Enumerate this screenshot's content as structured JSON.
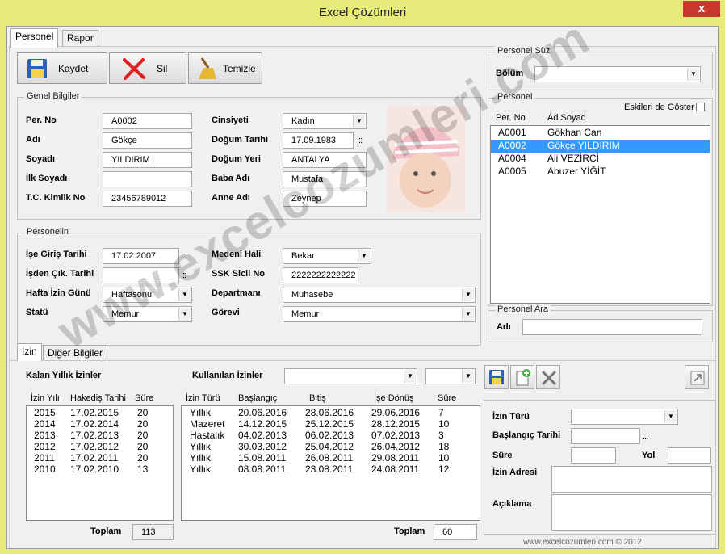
{
  "window": {
    "title": "Excel Çözümleri",
    "close_glyph": "x"
  },
  "tabs": [
    {
      "label": "Personel"
    },
    {
      "label": "Rapor"
    }
  ],
  "toolbar": {
    "save_label": "Kaydet",
    "delete_label": "Sil",
    "clear_label": "Temizle"
  },
  "general": {
    "legend": "Genel Bilgiler",
    "per_no_label": "Per. No",
    "per_no": "A0002",
    "adi_label": "Adı",
    "adi": "Gökçe",
    "soyadi_label": "Soyadı",
    "soyadi": "YILDIRIM",
    "ilk_soyadi_label": "İlk Soyadı",
    "ilk_soyadi": "",
    "tc_label": "T.C. Kimlik No",
    "tc": "23456789012",
    "cinsiyet_label": "Cinsiyeti",
    "cinsiyet": "Kadın",
    "dogum_tarihi_label": "Doğum Tarihi",
    "dogum_tarihi": "17.09.1983",
    "dogum_yeri_label": "Doğum Yeri",
    "dogum_yeri": "ANTALYA",
    "baba_label": "Baba Adı",
    "baba": "Mustafa",
    "anne_label": "Anne Adı",
    "anne": "Zeynep",
    "date_dots": ":::"
  },
  "personnel": {
    "legend": "Personelin",
    "giris_label": "İşe Giriş Tarihi",
    "giris": "17.02.2007",
    "cikis_label": "İşden Çık. Tarihi",
    "cikis": "",
    "izin_gunu_label": "Hafta İzin Günü",
    "izin_gunu": "Haftasonu",
    "statu_label": "Statü",
    "statu": "Memur",
    "medeni_label": "Medeni Hali",
    "medeni": "Bekar",
    "ssk_label": "SSK Sicil  No",
    "ssk": "2222222222222",
    "departman_label": "Departmanı",
    "departman": "Muhasebe",
    "gorev_label": "Görevi",
    "gorev": "Memur"
  },
  "filter": {
    "legend": "Personel Süz",
    "bolum_label": "Bölüm",
    "bolum": ""
  },
  "personnel_list": {
    "legend": "Personel",
    "show_old_label": "Eskileri de Göster",
    "columns": [
      "Per. No",
      "Ad Soyad"
    ],
    "rows": [
      {
        "no": "A0001",
        "name": "Gökhan Can"
      },
      {
        "no": "A0002",
        "name": "Gökçe YILDIRIM"
      },
      {
        "no": "A0004",
        "name": "Ali VEZİRCİ"
      },
      {
        "no": "A0005",
        "name": "Abuzer YİĞİT"
      }
    ],
    "selected_index": 1
  },
  "search": {
    "legend": "Personel Ara",
    "adi_label": "Adı",
    "adi": ""
  },
  "subtabs": [
    {
      "label": "İzin"
    },
    {
      "label": "Diğer Bilgiler"
    }
  ],
  "leave": {
    "remaining_label": "Kalan Yıllık İzinler",
    "used_label": "Kullanılan İzinler",
    "remaining_columns": [
      "İzin Yılı",
      "Hakediş Tarihi",
      "Süre"
    ],
    "remaining_rows": [
      {
        "year": "2015",
        "date": "17.02.2015",
        "days": "20"
      },
      {
        "year": "2014",
        "date": "17.02.2014",
        "days": "20"
      },
      {
        "year": "2013",
        "date": "17.02.2013",
        "days": "20"
      },
      {
        "year": "2012",
        "date": "17.02.2012",
        "days": "20"
      },
      {
        "year": "2011",
        "date": "17.02.2011",
        "days": "20"
      },
      {
        "year": "2010",
        "date": "17.02.2010",
        "days": "13"
      }
    ],
    "used_columns": [
      "İzin Türü",
      "Başlangıç",
      "Bitiş",
      "İşe Dönüş",
      "Süre"
    ],
    "used_rows": [
      {
        "type": "Yıllık",
        "start": "20.06.2016",
        "end": "28.06.2016",
        "return": "29.06.2016",
        "days": "7"
      },
      {
        "type": "Mazeret",
        "start": "14.12.2015",
        "end": "25.12.2015",
        "return": "28.12.2015",
        "days": "10"
      },
      {
        "type": "Hastalık",
        "start": "04.02.2013",
        "end": "06.02.2013",
        "return": "07.02.2013",
        "days": "3"
      },
      {
        "type": "Yıllık",
        "start": "30.03.2012",
        "end": "25.04.2012",
        "return": "26.04.2012",
        "days": "18"
      },
      {
        "type": "Yıllık",
        "start": "15.08.2011",
        "end": "26.08.2011",
        "return": "29.08.2011",
        "days": "10"
      },
      {
        "type": "Yıllık",
        "start": "08.08.2011",
        "end": "23.08.2011",
        "return": "24.08.2011",
        "days": "12"
      }
    ],
    "total_label": "Toplam",
    "remaining_total": "113",
    "used_total": "60"
  },
  "leave_form": {
    "type_label": "İzin Türü",
    "start_label": "Başlangıç Tarihi",
    "duration_label": "Süre",
    "road_label": "Yol",
    "address_label": "İzin Adresi",
    "note_label": "Açıklama"
  },
  "footer": "www.excelcozumleri.com © 2012",
  "watermark": "www.excelcozumleri.com"
}
